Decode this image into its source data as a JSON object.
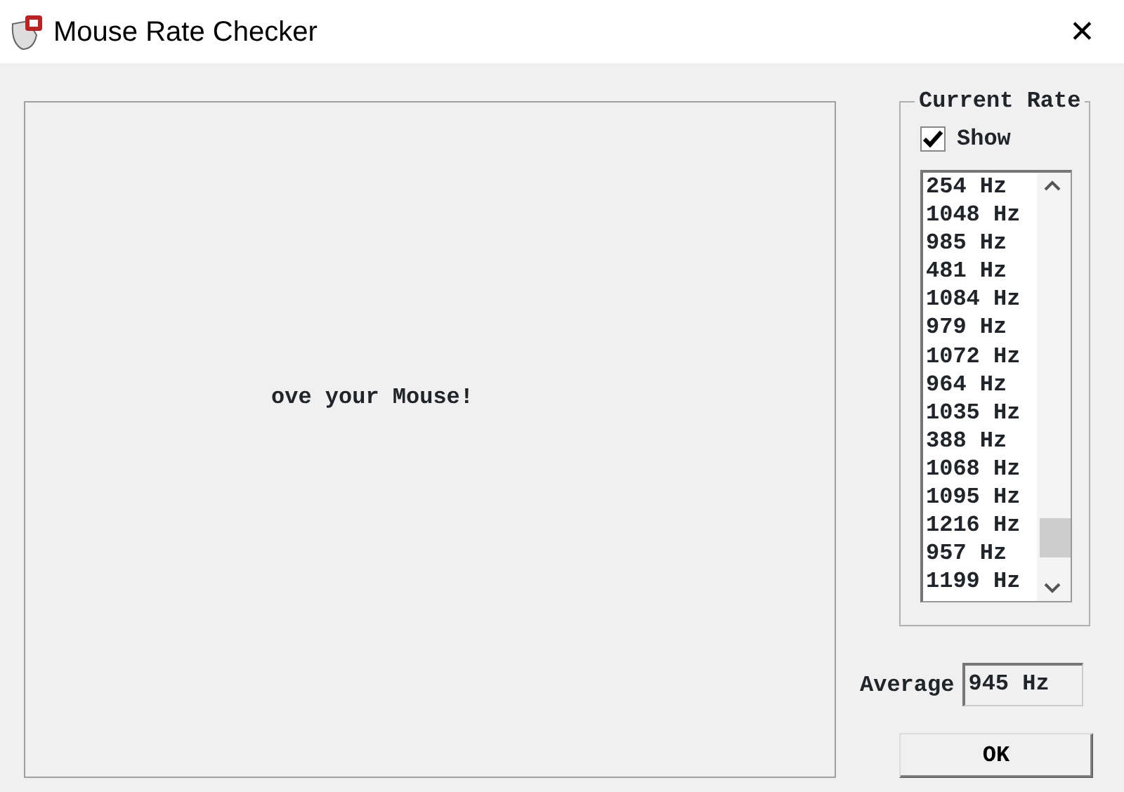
{
  "window": {
    "title": "Mouse Rate Checker",
    "close": "✕"
  },
  "canvas": {
    "message": "ove your Mouse!"
  },
  "current_rate": {
    "title": "Current Rate",
    "show": {
      "label": "Show",
      "checked": true
    },
    "rates": [
      "254 Hz",
      "1048 Hz",
      "985 Hz",
      "481 Hz",
      "1084 Hz",
      "979 Hz",
      "1072 Hz",
      "964 Hz",
      "1035 Hz",
      "388 Hz",
      "1068 Hz",
      "1095 Hz",
      "1216 Hz",
      "957 Hz",
      "1199 Hz"
    ]
  },
  "average": {
    "label": "Average",
    "value": "945 Hz"
  },
  "buttons": [
    "OK"
  ]
}
